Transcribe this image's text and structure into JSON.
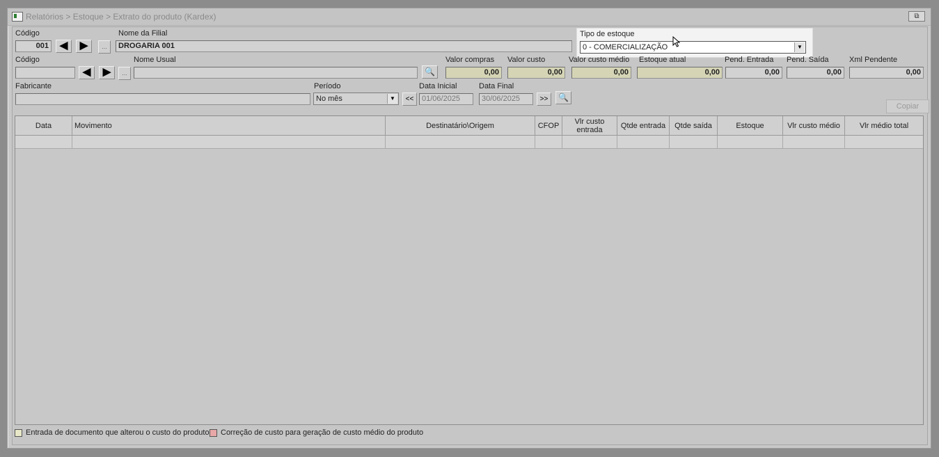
{
  "window": {
    "title": "Relatórios > Estoque > Extrato do produto (Kardex)",
    "restore_label": "⧉"
  },
  "filial": {
    "codigo_label": "Código",
    "codigo_value": "001",
    "more_label": "...",
    "nome_label": "Nome da Filial",
    "nome_value": "DROGARIA 001"
  },
  "tipo_estoque": {
    "label": "Tipo de estoque",
    "value": "0 - COMERCIALIZAÇÃO"
  },
  "produto": {
    "codigo_label": "Código",
    "codigo_value": "",
    "more_label": "...",
    "nome_usual_label": "Nome Usual",
    "nome_usual_value": ""
  },
  "valores": [
    {
      "label": "Valor compras",
      "value": "0,00"
    },
    {
      "label": "Valor custo",
      "value": "0,00"
    },
    {
      "label": "Valor custo médio",
      "value": "0,00"
    },
    {
      "label": "Estoque atual",
      "value": "0,00"
    },
    {
      "label": "Pend. Entrada",
      "value": "0,00"
    },
    {
      "label": "Pend. Saída",
      "value": "0,00"
    },
    {
      "label": "Xml Pendente",
      "value": "0,00"
    }
  ],
  "fabricante": {
    "label": "Fabricante",
    "value": ""
  },
  "periodo": {
    "label": "Período",
    "value": "No mês",
    "prev_label": "<<",
    "next_label": ">>"
  },
  "datas": {
    "inicial_label": "Data Inicial",
    "inicial_value": "01/06/2025",
    "final_label": "Data Final",
    "final_value": "30/06/2025"
  },
  "copiar_label": "Copiar",
  "table": {
    "columns": [
      "Data",
      "Movimento",
      "Destinatário\\Origem",
      "CFOP",
      "Vlr custo entrada",
      "Qtde entrada",
      "Qtde saída",
      "Estoque",
      "Vlr custo médio",
      "Vlr médio total"
    ]
  },
  "legend": [
    {
      "label": "Entrada de documento que alterou o custo do produto",
      "color": "#e8e8c8"
    },
    {
      "label": "Correção de custo para geração de custo médio do produto",
      "color": "#e8a8a8"
    }
  ],
  "icons": {
    "prev": "arrow-left-icon",
    "next": "arrow-right-icon",
    "search": "search-icon",
    "dropdown": "chevron-down-icon"
  }
}
